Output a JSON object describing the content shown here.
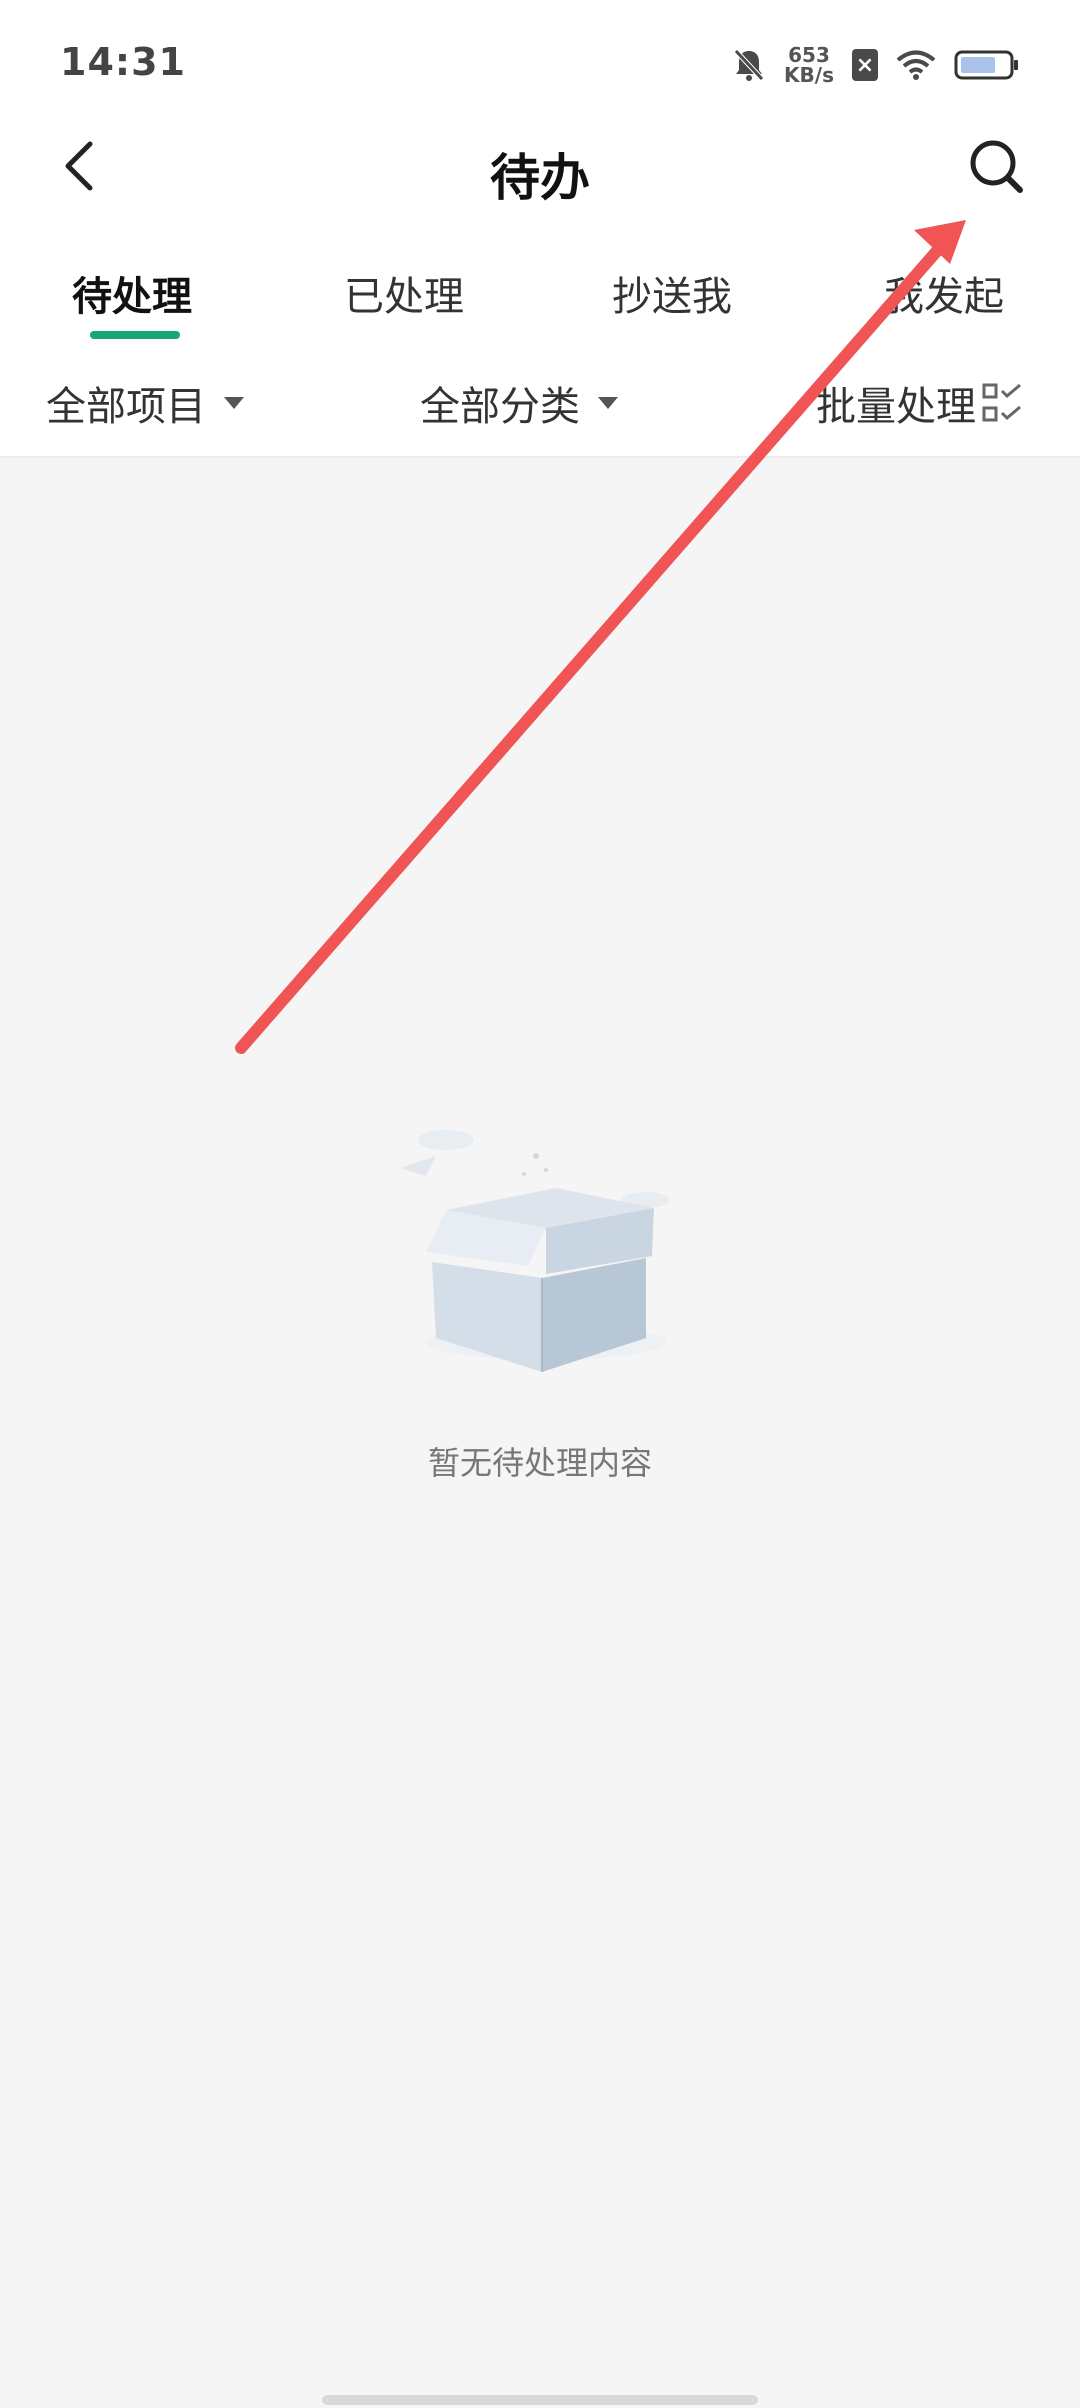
{
  "status_bar": {
    "time": "14:31",
    "net_speed_value": "653",
    "net_speed_unit": "KB/s",
    "sim_label": "×"
  },
  "header": {
    "title": "待办"
  },
  "tabs": [
    {
      "label": "待处理",
      "active": true
    },
    {
      "label": "已处理",
      "active": false
    },
    {
      "label": "抄送我",
      "active": false
    },
    {
      "label": "我发起",
      "active": false
    }
  ],
  "filters": {
    "project": "全部项目",
    "category": "全部分类",
    "batch": "批量处理"
  },
  "empty_state": {
    "text": "暂无待处理内容"
  },
  "colors": {
    "accent": "#17a675",
    "annotation_arrow": "#f05454"
  },
  "icons": [
    "bell-mute-icon",
    "sim-off-icon",
    "wifi-icon",
    "battery-icon",
    "back-icon",
    "search-icon",
    "caret-down-icon",
    "batch-check-icon",
    "empty-box-icon"
  ]
}
